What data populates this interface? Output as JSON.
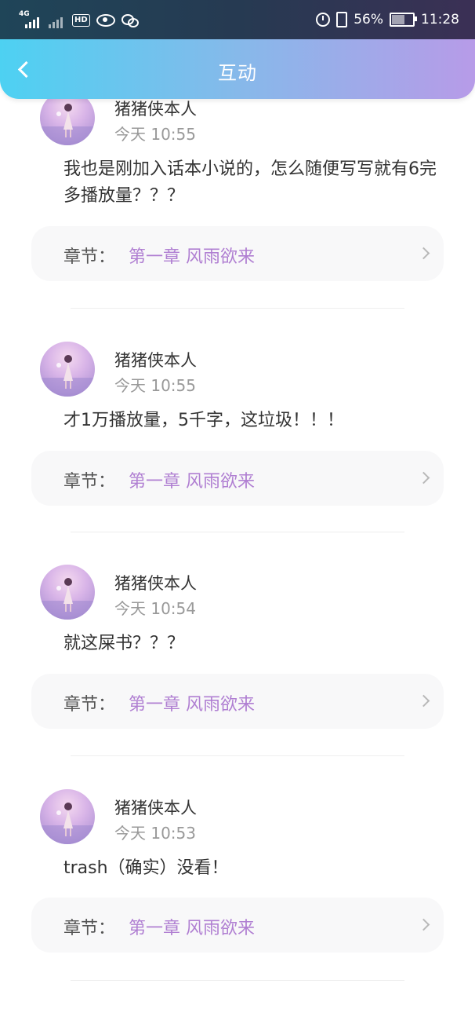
{
  "status_bar": {
    "network_type": "4G",
    "hd_badge": "HD",
    "battery_percent": "56%",
    "time": "11:28",
    "battery_level": 0.56
  },
  "header": {
    "title": "互动"
  },
  "comments": [
    {
      "username": "猪猪侠本人",
      "time": "今天 10:55",
      "text": "我也是刚加入话本小说的，怎么随便写写就有6完多播放量？？？",
      "chapter_label": "章节：",
      "chapter_name": "第一章 风雨欲来"
    },
    {
      "username": "猪猪侠本人",
      "time": "今天 10:55",
      "text": "才1万播放量，5千字，这垃圾！！！",
      "chapter_label": "章节：",
      "chapter_name": "第一章 风雨欲来"
    },
    {
      "username": "猪猪侠本人",
      "time": "今天 10:54",
      "text": "就这屎书？？？",
      "chapter_label": "章节：",
      "chapter_name": "第一章 风雨欲来"
    },
    {
      "username": "猪猪侠本人",
      "time": "今天 10:53",
      "text": "trash（确实）没看！",
      "chapter_label": "章节：",
      "chapter_name": "第一章 风雨欲来"
    }
  ],
  "colors": {
    "header_gradient_start": "#4dd1f2",
    "header_gradient_end": "#b79be8",
    "chapter_accent": "#b07fd2"
  }
}
